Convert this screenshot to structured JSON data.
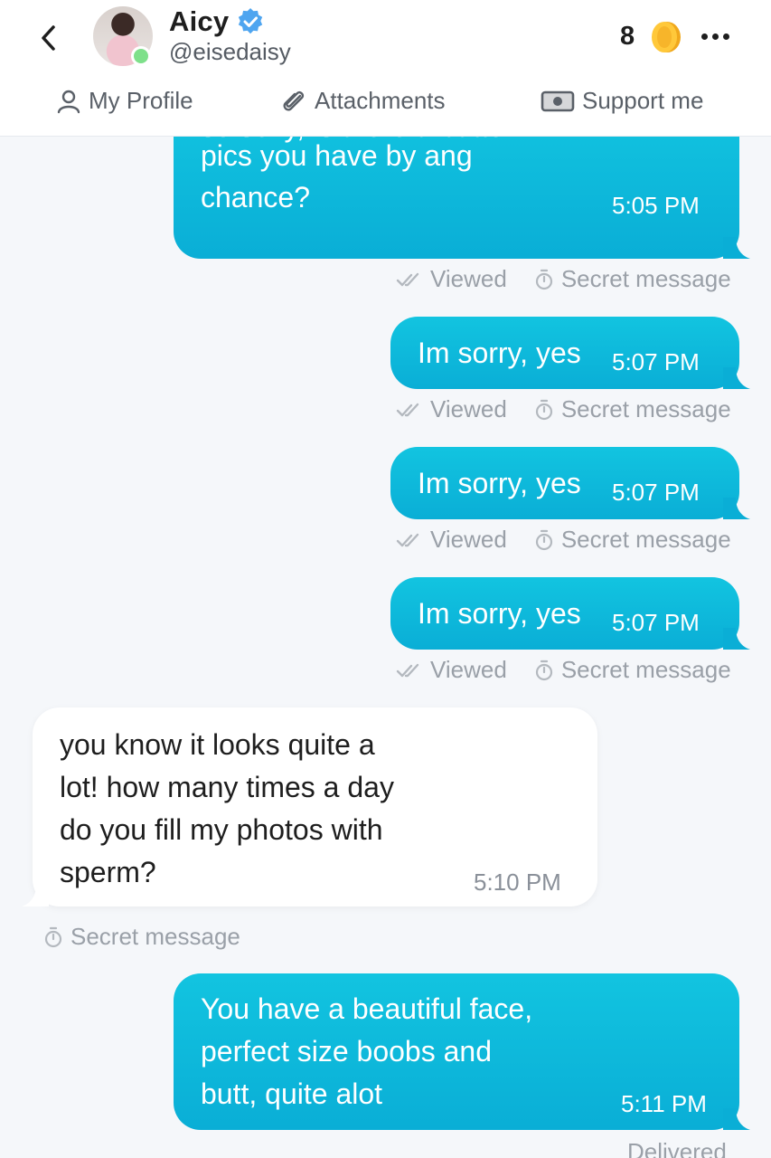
{
  "header": {
    "name": "Aicy",
    "handle": "@eisedaisy",
    "coins": "8"
  },
  "nav": {
    "profile": "My Profile",
    "attachments": "Attachments",
    "support": "Support me"
  },
  "messages": [
    {
      "dir": "out",
      "text_lines": [
        "so sexy, is there a button",
        "pics you have by ang",
        "chance?"
      ],
      "time": "5:05 PM",
      "status": "Viewed",
      "secret": "Secret message"
    },
    {
      "dir": "out",
      "text": "Im sorry, yes",
      "time": "5:07 PM",
      "status": "Viewed",
      "secret": "Secret message"
    },
    {
      "dir": "out",
      "text": "Im sorry, yes",
      "time": "5:07 PM",
      "status": "Viewed",
      "secret": "Secret message"
    },
    {
      "dir": "out",
      "text": "Im sorry, yes",
      "time": "5:07 PM",
      "status": "Viewed",
      "secret": "Secret message"
    },
    {
      "dir": "in",
      "text_lines": [
        "you know it looks quite a",
        "lot! how many times a day",
        "do you fill my photos with",
        "sperm?"
      ],
      "time": "5:10 PM",
      "secret": "Secret message"
    },
    {
      "dir": "out",
      "text_lines": [
        "You have a beautiful face,",
        "perfect size boobs and",
        "butt, quite alot"
      ],
      "time": "5:11 PM",
      "status": "Delivered"
    }
  ],
  "colors": {
    "accent": "#0fbadb",
    "verified": "#4ea5f0",
    "online": "#7ee08a"
  }
}
